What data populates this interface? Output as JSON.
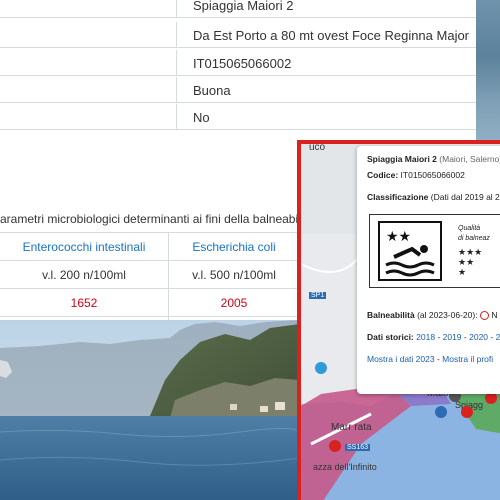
{
  "info_table": {
    "rows": [
      {
        "value": "Spiaggia Maiori 2"
      },
      {
        "value": "Da Est Porto a 80 mt ovest Foce Reginna Major"
      },
      {
        "value": "IT015065066002"
      },
      {
        "value": "Buona"
      },
      {
        "value": "No"
      }
    ]
  },
  "params": {
    "title": "arametri microbiologici determinanti ai fini della balneabilità",
    "headers": [
      "Enterococchi intestinali",
      "Escherichia coli"
    ],
    "limits": [
      "v.l. 200 n/100ml",
      "v.l. 500 n/100ml"
    ],
    "values": [
      "1652",
      "2005"
    ],
    "value_color": "#d0021b",
    "header_color": "#1a73c8"
  },
  "map": {
    "labels": {
      "top_place": "uco",
      "town": "Maiori",
      "town2": "Marr  rata",
      "road": "SP1",
      "road2": "SS163",
      "piazza": "azza dell'Infinito",
      "spiagge": "Spiagg"
    },
    "popup": {
      "title": "Spiaggia Maiori 2",
      "title_suffix": "(Maiori, Salerno)",
      "codice_label": "Codice:",
      "codice_value": "IT015065066002",
      "classificazione_label": "Classificazione",
      "classificazione_suffix": "(Dati dal 2019 al 2",
      "badge_title_1": "Qualità",
      "badge_title_2": "di balneaz",
      "balneabilita_label": "Balneabilità",
      "balneabilita_date": "(al 2023-06-20):",
      "balneabilita_status": "N",
      "dati_label": "Dati storici:",
      "years": [
        "2018",
        "2019",
        "2020",
        "2"
      ],
      "mostra_dati": "Mostra i dati 2023",
      "mostra_profilo": "Mostra il profi"
    }
  }
}
